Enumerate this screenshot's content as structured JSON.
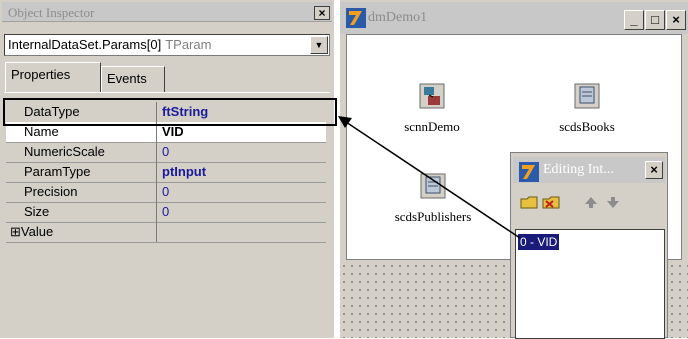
{
  "object_inspector": {
    "title": "Object Inspector",
    "close_glyph": "×",
    "combo": {
      "object": "InternalDataSet.Params[0]",
      "type": "TParam",
      "dropdown_glyph": "▼"
    },
    "tabs": [
      {
        "label": "Properties"
      },
      {
        "label": "Events"
      }
    ],
    "properties": [
      {
        "name": "DataType",
        "value": "ftString"
      },
      {
        "name": "Name",
        "value": "VID"
      },
      {
        "name": "NumericScale",
        "value": "0"
      },
      {
        "name": "ParamType",
        "value": "ptInput"
      },
      {
        "name": "Precision",
        "value": "0"
      },
      {
        "name": "Size",
        "value": "0"
      },
      {
        "name": "⊞Value",
        "value": ""
      }
    ]
  },
  "form": {
    "title": "dmDemo1",
    "buttons": {
      "minimize": "_",
      "maximize": "□",
      "close": "×"
    },
    "components": [
      {
        "label": "scnnDemo"
      },
      {
        "label": "scdsBooks"
      },
      {
        "label": "scdsPublishers"
      }
    ]
  },
  "editor": {
    "title": "Editing Int...",
    "close_glyph": "×",
    "list": [
      "0 - VID"
    ]
  },
  "colors": {
    "selection": "#1a1a7a",
    "value_text": "#1a1a9a",
    "panel": "#d4d0c8"
  }
}
